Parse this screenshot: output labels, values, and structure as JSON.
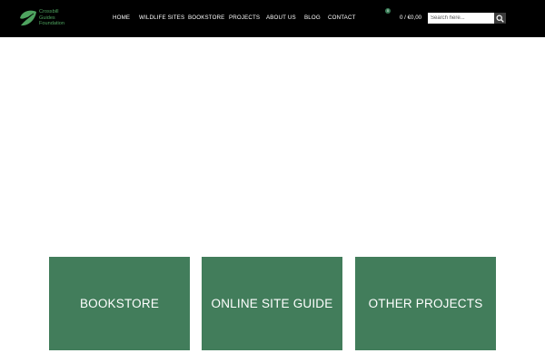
{
  "header": {
    "logo": {
      "name": "Crossbill Guides Foundation",
      "lines": [
        "Crossbill",
        "Guides",
        "Foundation"
      ],
      "icon": "crossbill-leaf-logo-icon",
      "color": "#4ea35f"
    },
    "nav": {
      "items": [
        {
          "label": "HOME"
        },
        {
          "label": "WILDLIFE SITES"
        },
        {
          "label": "BOOKSTORE"
        },
        {
          "label": "PROJECTS"
        },
        {
          "label": "ABOUT US"
        },
        {
          "label": "BLOG"
        },
        {
          "label": "CONTACT"
        }
      ]
    },
    "cart": {
      "badge_count": "0",
      "summary": "0 / €0,00"
    },
    "search": {
      "placeholder": "Search here...",
      "value": "",
      "icon": "search-icon"
    }
  },
  "tiles": [
    {
      "label": "BOOKSTORE"
    },
    {
      "label": "ONLINE SITE GUIDE"
    },
    {
      "label": "OTHER PROJECTS"
    }
  ],
  "colors": {
    "header_bg": "#000000",
    "tile_bg": "#427d5b",
    "accent": "#3a7d57",
    "page_bg": "#ffffff"
  }
}
